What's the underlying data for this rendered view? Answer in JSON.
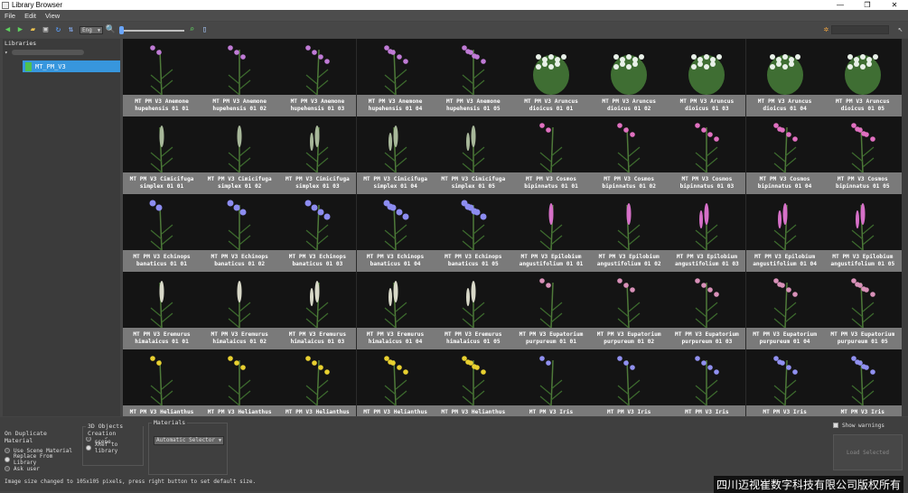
{
  "window": {
    "title": "Library Browser",
    "controls": [
      "—",
      "❐",
      "✕"
    ]
  },
  "menu": [
    "File",
    "Edit",
    "View"
  ],
  "toolbar": {
    "size_select": "Eng",
    "zoom_level": 0
  },
  "libraries": {
    "title": "Libraries",
    "root": "",
    "item": "MT_PM_V3"
  },
  "rows": [
    {
      "name": "MT PM V3 Anemone",
      "name2": "hupehensis",
      "color": "#c07bd6",
      "kind": "tall"
    },
    {
      "name": "MT PM V3 Aruncus",
      "name2": "dioicus",
      "color": "#e8f0e8",
      "kind": "bush"
    },
    {
      "name": "MT PM V3 Cimicifuga",
      "name2": "simplex",
      "color": "#a8b89a",
      "kind": "spike"
    },
    {
      "name": "MT PM V3 Cosmos",
      "name2": "bipinnatus",
      "color": "#e070c0",
      "kind": "tall"
    },
    {
      "name": "MT PM V3 Echinops",
      "name2": "banaticus",
      "color": "#8c8cf0",
      "kind": "ball"
    },
    {
      "name": "MT PM V3 Epilobium",
      "name2": "angustifolium",
      "color": "#d670c8",
      "kind": "spike"
    },
    {
      "name": "MT PM V3 Eremurus",
      "name2": "himalaicus",
      "color": "#d8d8c8",
      "kind": "spike"
    },
    {
      "name": "MT PM V3 Eupatorium",
      "name2": "purpureum",
      "color": "#d890b8",
      "kind": "tall"
    },
    {
      "name": "MT PM V3 Helianthus",
      "name2": "",
      "color": "#e8d030",
      "kind": "tall"
    },
    {
      "name": "MT PM V3 Iris",
      "name2": "",
      "color": "#9090f0",
      "kind": "tall"
    }
  ],
  "grid": [
    [
      "MT PM V3 Anemone hupehensis 01 01",
      "MT PM V3 Anemone hupehensis 01 02",
      "MT PM V3 Anemone hupehensis 01 03",
      "MT PM V3 Anemone hupehensis 01 04",
      "MT PM V3 Anemone hupehensis 01 05",
      "MT PM V3 Aruncus dioicus 01 01",
      "MT PM V3 Aruncus dioicus 01 02",
      "MT PM V3 Aruncus dioicus 01 03",
      "MT PM V3 Aruncus dioicus 01 04",
      "MT PM V3 Aruncus dioicus 01 05"
    ],
    [
      "MT PM V3 Cimicifuga simplex 01 01",
      "MT PM V3 Cimicifuga simplex 01 02",
      "MT PM V3 Cimicifuga simplex 01 03",
      "MT PM V3 Cimicifuga simplex 01 04",
      "MT PM V3 Cimicifuga simplex 01 05",
      "MT PM V3 Cosmos bipinnatus 01 01",
      "MT PM V3 Cosmos bipinnatus 01 02",
      "MT PM V3 Cosmos bipinnatus 01 03",
      "MT PM V3 Cosmos bipinnatus 01 04",
      "MT PM V3 Cosmos bipinnatus 01 05"
    ],
    [
      "MT PM V3 Echinops banaticus 01 01",
      "MT PM V3 Echinops banaticus 01 02",
      "MT PM V3 Echinops banaticus 01 03",
      "MT PM V3 Echinops banaticus 01 04",
      "MT PM V3 Echinops banaticus 01 05",
      "MT PM V3 Epilobium angustifolium 01 01",
      "MT PM V3 Epilobium angustifolium 01 02",
      "MT PM V3 Epilobium angustifolium 01 03",
      "MT PM V3 Epilobium angustifolium 01 04",
      "MT PM V3 Epilobium angustifolium 01 05"
    ],
    [
      "MT PM V3 Eremurus himalaicus 01 01",
      "MT PM V3 Eremurus himalaicus 01 02",
      "MT PM V3 Eremurus himalaicus 01 03",
      "MT PM V3 Eremurus himalaicus 01 04",
      "MT PM V3 Eremurus himalaicus 01 05",
      "MT PM V3 Eupatorium purpureum 01 01",
      "MT PM V3 Eupatorium purpureum 01 02",
      "MT PM V3 Eupatorium purpureum 01 03",
      "MT PM V3 Eupatorium purpureum 01 04",
      "MT PM V3 Eupatorium purpureum 01 05"
    ],
    [
      "MT PM V3 Helianthus",
      "MT PM V3 Helianthus",
      "MT PM V3 Helianthus",
      "MT PM V3 Helianthus",
      "MT PM V3 Helianthus",
      "MT PM V3 Iris",
      "MT PM V3 Iris",
      "MT PM V3 Iris",
      "MT PM V3 Iris",
      "MT PM V3 Iris"
    ]
  ],
  "duplicate": {
    "title": "On Duplicate Material",
    "options": [
      "Use Scene Material",
      "Replace From Library",
      "Ask user"
    ],
    "selected": 1
  },
  "creation": {
    "title": "3D Objects Creation",
    "options": [
      "Merge into scene",
      "XRef to library"
    ],
    "selected": 1
  },
  "materials": {
    "title": "Materials",
    "select": "Automatic Selector"
  },
  "show_warnings": "Show warnings",
  "load_selected": "Load Selected",
  "status": "Image size changed to 105x105 pixels, press right button to set default size.",
  "watermark": "四川迈视崔数字科技有限公司版权所有"
}
